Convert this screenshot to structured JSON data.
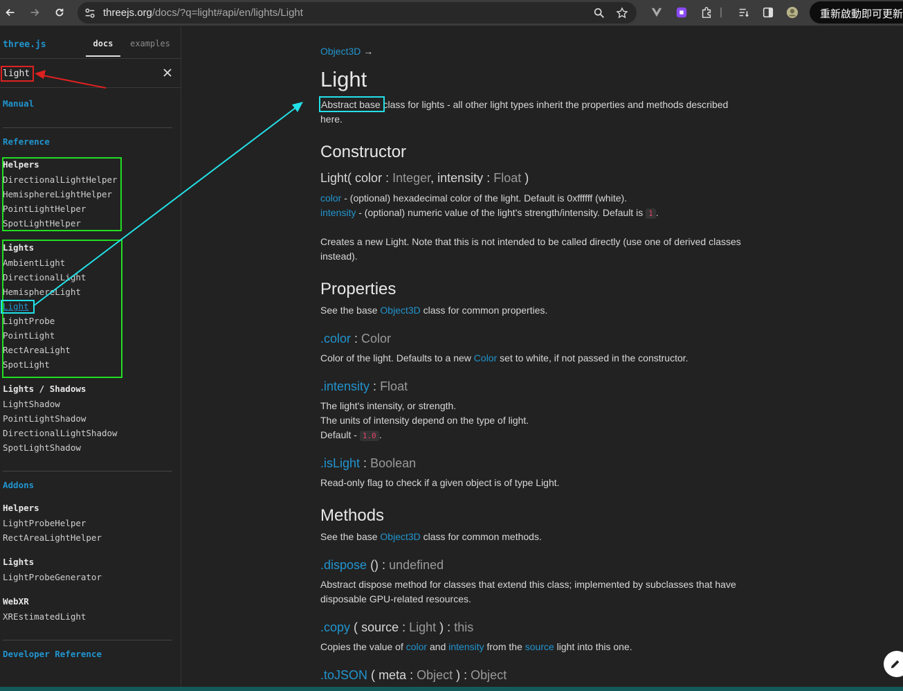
{
  "browser": {
    "url_host": "threejs.org",
    "url_path": "/docs/?q=light#api/en/lights/Light",
    "update_label": "重新啟動即可更新"
  },
  "sidebar": {
    "brand": "three.js",
    "tabs": [
      "docs",
      "examples"
    ],
    "search_value": "light",
    "manual": "Manual",
    "reference": "Reference",
    "helpers_head": "Helpers",
    "helpers": [
      "DirectionalLightHelper",
      "HemisphereLightHelper",
      "PointLightHelper",
      "SpotLightHelper"
    ],
    "lights_head": "Lights",
    "lights": [
      "AmbientLight",
      "DirectionalLight",
      "HemisphereLight",
      "Light",
      "LightProbe",
      "PointLight",
      "RectAreaLight",
      "SpotLight"
    ],
    "shadows_head": "Lights / Shadows",
    "shadows": [
      "LightShadow",
      "PointLightShadow",
      "DirectionalLightShadow",
      "SpotLightShadow"
    ],
    "addons": "Addons",
    "addons_helpers_head": "Helpers",
    "addons_helpers": [
      "LightProbeHelper",
      "RectAreaLightHelper"
    ],
    "addons_lights_head": "Lights",
    "addons_lights": [
      "LightProbeGenerator"
    ],
    "webxr_head": "WebXR",
    "webxr": [
      "XREstimatedLight"
    ],
    "developer_reference": "Developer Reference"
  },
  "content": {
    "breadcrumb": "Object3D",
    "breadcrumb_arrow": "→",
    "title": "Light",
    "intro_highlight": "Abstract base",
    "intro_rest_1": " class for lights - all other light types inherit the properties and methods described",
    "intro_rest_2": "here.",
    "constructor_head": "Constructor",
    "ctor_name": "Light(",
    "ctor_p1": "color",
    "ctor_t1": "Integer",
    "ctor_p2": "intensity",
    "ctor_t2": "Float",
    "ctor_close": ")",
    "color_param": "color",
    "color_desc": " - (optional) hexadecimal color of the light. Default is 0xffffff (white).",
    "intensity_param": "intensity",
    "intensity_desc": " - (optional) numeric value of the light's strength/intensity. Default is",
    "intensity_default": "1",
    "creates_1": "Creates a new Light. Note that this is not intended to be called directly (use one of derived classes",
    "creates_2": "instead).",
    "properties_head": "Properties",
    "props_see_pre": "See the base ",
    "props_see_link": "Object3D",
    "props_see_post": " class for common properties.",
    "prop_color": ".color",
    "prop_color_type": "Color",
    "prop_color_desc_pre": "Color of the light. Defaults to a new ",
    "prop_color_desc_link": "Color",
    "prop_color_desc_post": " set to white, if not passed in the constructor.",
    "prop_intensity": ".intensity",
    "prop_intensity_type": "Float",
    "prop_intensity_l1": "The light's intensity, or strength.",
    "prop_intensity_l2": "The units of intensity depend on the type of light.",
    "prop_intensity_l3": "Default - ",
    "prop_intensity_default": "1.0",
    "prop_islight": ".isLight",
    "prop_islight_type": "Boolean",
    "prop_islight_desc": "Read-only flag to check if a given object is of type Light.",
    "methods_head": "Methods",
    "methods_see_pre": "See the base ",
    "methods_see_link": "Object3D",
    "methods_see_post": " class for common methods.",
    "m_dispose": ".dispose",
    "m_dispose_sig": "() :",
    "m_dispose_ret": "undefined",
    "m_dispose_l1": "Abstract dispose method for classes that extend this class; implemented by subclasses that have",
    "m_dispose_l2": "disposable GPU-related resources.",
    "m_copy": ".copy",
    "m_copy_open": "(",
    "m_copy_param": "source",
    "m_copy_type": "Light",
    "m_copy_close": ") :",
    "m_copy_ret": "this",
    "m_copy_d1": "Copies the value of ",
    "m_copy_d_color": "color",
    "m_copy_d2": " and ",
    "m_copy_d_intensity": "intensity",
    "m_copy_d3": " from the ",
    "m_copy_d_source": "source",
    "m_copy_d4": " light into this one.",
    "m_tojson": ".toJSON",
    "m_tojson_open": "(",
    "m_tojson_param": "meta",
    "m_tojson_type": "Object",
    "m_tojson_close": ") :",
    "m_tojson_ret": "Object"
  },
  "colors": {
    "link": "#2194ce",
    "annotation_red": "#e02020",
    "annotation_green": "#22dd22",
    "annotation_cyan": "#22e0e8"
  }
}
